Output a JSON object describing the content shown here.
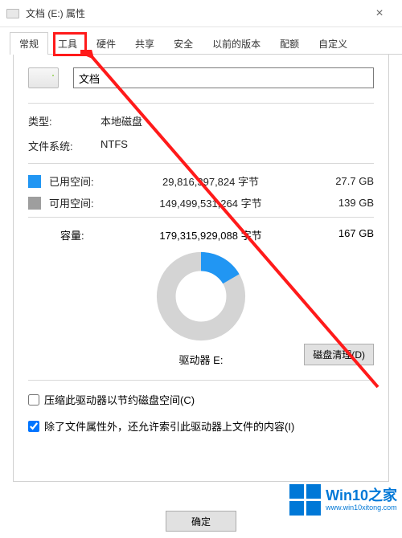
{
  "window": {
    "title": "文档 (E:) 属性",
    "close_icon": "×"
  },
  "tabs": {
    "items": [
      {
        "label": "常规"
      },
      {
        "label": "工具"
      },
      {
        "label": "硬件"
      },
      {
        "label": "共享"
      },
      {
        "label": "安全"
      },
      {
        "label": "以前的版本"
      },
      {
        "label": "配额"
      },
      {
        "label": "自定义"
      }
    ]
  },
  "general": {
    "name_value": "文档",
    "type_label": "类型:",
    "type_value": "本地磁盘",
    "fs_label": "文件系统:",
    "fs_value": "NTFS",
    "used_label": "已用空间:",
    "used_bytes": "29,816,397,824 字节",
    "used_hr": "27.7 GB",
    "free_label": "可用空间:",
    "free_bytes": "149,499,531,264 字节",
    "free_hr": "139 GB",
    "cap_label": "容量:",
    "cap_bytes": "179,315,929,088 字节",
    "cap_hr": "167 GB",
    "drive_label": "驱动器 E:",
    "cleanup_btn": "磁盘清理(D)",
    "compress_label": "压缩此驱动器以节约磁盘空间(C)",
    "index_label": "除了文件属性外，还允许索引此驱动器上文件的内容(I)",
    "compress_checked": false,
    "index_checked": true
  },
  "buttons": {
    "ok": "确定"
  },
  "colors": {
    "used": "#2196F3",
    "free": "#d4d4d4",
    "highlight": "#ff1a1a",
    "accent": "#0078d7"
  },
  "watermark": {
    "brand": "Win10",
    "tag": "之家",
    "url": "www.win10xitong.com"
  },
  "chart_data": {
    "type": "pie",
    "title": "驱动器 E:",
    "series": [
      {
        "name": "已用空间",
        "value": 29816397824,
        "label": "27.7 GB",
        "color": "#2196F3"
      },
      {
        "name": "可用空间",
        "value": 149499531264,
        "label": "139 GB",
        "color": "#d4d4d4"
      }
    ],
    "total": {
      "name": "容量",
      "value": 179315929088,
      "label": "167 GB"
    }
  }
}
